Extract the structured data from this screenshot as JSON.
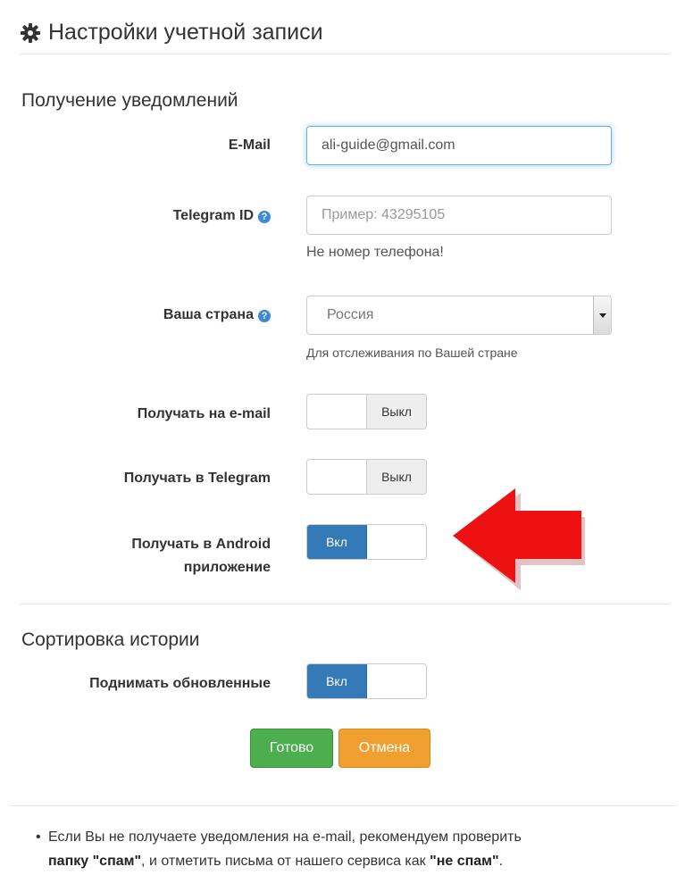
{
  "page": {
    "title": "Настройки учетной записи"
  },
  "notifications": {
    "section_title": "Получение уведомлений",
    "email_label": "E-Mail",
    "email_value": "ali-guide@gmail.com",
    "telegram_label": "Telegram ID",
    "telegram_placeholder": "Пример: 43295105",
    "telegram_hint": "Не номер телефона!",
    "country_label": "Ваша страна",
    "country_value": "Россия",
    "country_hint": "Для отслеживания по Вашей стране",
    "receive_email_label": "Получать на e-mail",
    "receive_email_state": "Выкл",
    "receive_telegram_label": "Получать в Telegram",
    "receive_telegram_state": "Выкл",
    "receive_android_label_line1": "Получать в Android",
    "receive_android_label_line2": "приложение",
    "receive_android_state": "Вкл"
  },
  "sorting": {
    "section_title": "Сортировка истории",
    "raise_updated_label": "Поднимать обновленные",
    "raise_updated_state": "Вкл"
  },
  "actions": {
    "save_label": "Готово",
    "cancel_label": "Отмена"
  },
  "note": {
    "text_part1": "Если Вы не получаете уведомления на e-mail, рекомендуем проверить",
    "spam_folder": "папку \"спам\"",
    "text_part2": ", и отметить письма от нашего сервиса как ",
    "not_spam": "\"не спам\"",
    "text_end": "."
  },
  "colors": {
    "toggle_on": "#337ab7",
    "save_button": "#4cae4c",
    "cancel_button": "#f0a030",
    "arrow": "#ee1111",
    "help_icon": "#3c8ad4"
  },
  "icons": {
    "title_icon": "gear-icon",
    "help_icon": "question-circle-icon",
    "annotation": "red-arrow-icon"
  }
}
